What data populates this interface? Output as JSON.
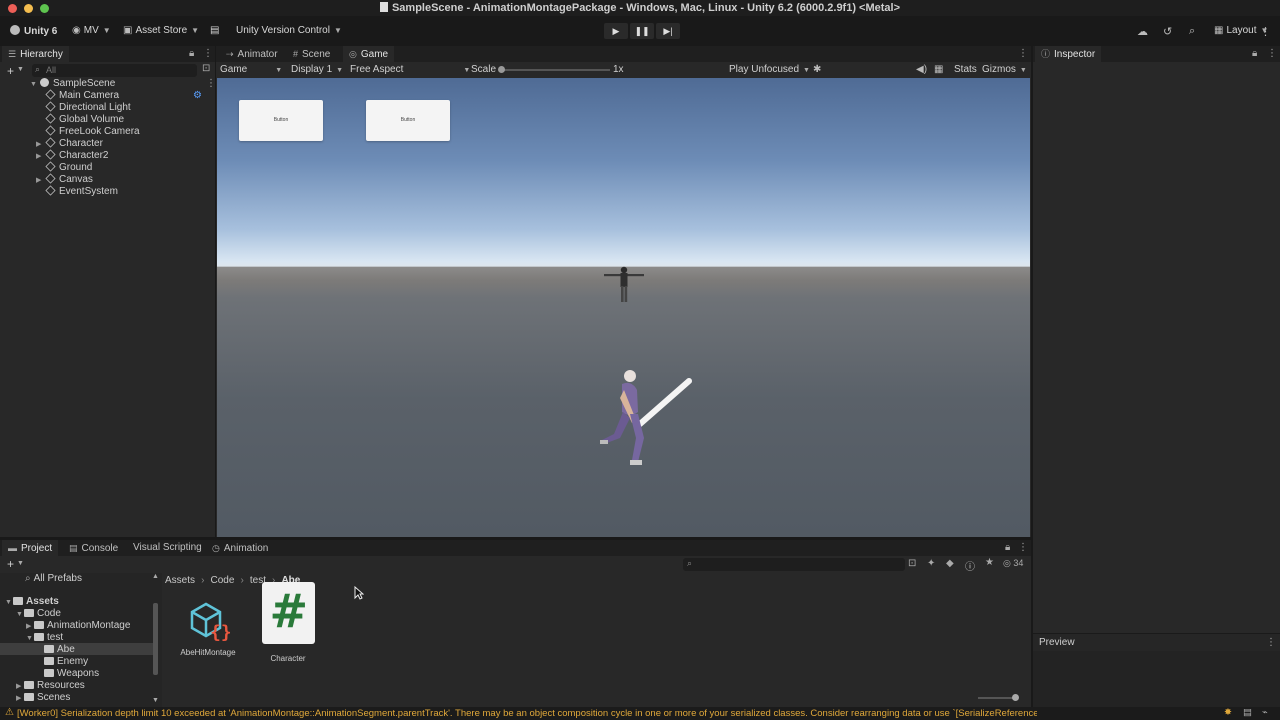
{
  "window": {
    "title": "SampleScene - AnimationMontagePackage - Windows, Mac, Linux - Unity 6.2 (6000.2.9f1) <Metal>"
  },
  "toolbar": {
    "unity_label": "Unity 6",
    "account_label": "MV",
    "asset_store_label": "Asset Store",
    "version_control_label": "Unity Version Control",
    "layout_label": "Layout"
  },
  "hierarchy": {
    "tab_label": "Hierarchy",
    "search_placeholder": "All",
    "scene_name": "SampleScene",
    "items": [
      {
        "label": "Main Camera"
      },
      {
        "label": "Directional Light"
      },
      {
        "label": "Global Volume"
      },
      {
        "label": "FreeLook Camera"
      },
      {
        "label": "Character"
      },
      {
        "label": "Character2"
      },
      {
        "label": "Ground"
      },
      {
        "label": "Canvas"
      },
      {
        "label": "EventSystem"
      }
    ]
  },
  "center_tabs": {
    "animator": "Animator",
    "scene": "Scene",
    "game": "Game"
  },
  "game_controls": {
    "mode": "Game",
    "display": "Display 1",
    "aspect": "Free Aspect",
    "scale_label": "Scale",
    "scale_value": "1x",
    "play_mode": "Play Unfocused",
    "stats": "Stats",
    "gizmos": "Gizmos"
  },
  "game_view": {
    "button1_label": "Button",
    "button2_label": "Button"
  },
  "inspector": {
    "tab_label": "Inspector",
    "preview_label": "Preview"
  },
  "bottom_tabs": {
    "project": "Project",
    "console": "Console",
    "visual_scripting": "Visual Scripting",
    "animation": "Animation"
  },
  "project": {
    "hidden_count": "34",
    "all_prefabs": "All Prefabs",
    "breadcrumb": [
      "Assets",
      "Code",
      "test",
      "Abe"
    ],
    "tree": [
      {
        "label": "Assets"
      },
      {
        "label": "Code"
      },
      {
        "label": "AnimationMontage"
      },
      {
        "label": "test"
      },
      {
        "label": "Abe"
      },
      {
        "label": "Enemy"
      },
      {
        "label": "Weapons"
      },
      {
        "label": "Resources"
      },
      {
        "label": "Scenes"
      }
    ],
    "assets": [
      {
        "label": "AbeHitMontage"
      },
      {
        "label": "Character"
      }
    ]
  },
  "status": {
    "message": "[Worker0] Serialization depth limit 10 exceeded at 'AnimationMontage::AnimationSegment.parentTrack'. There may be an object composition cycle in one or more of your serialized classes. Consider rearranging data or use `[SerializeReference]`."
  },
  "colors": {
    "warning": "#e0a83a",
    "selected_row": "#3e3e3e",
    "play_highlight": "#3a3a3a"
  }
}
